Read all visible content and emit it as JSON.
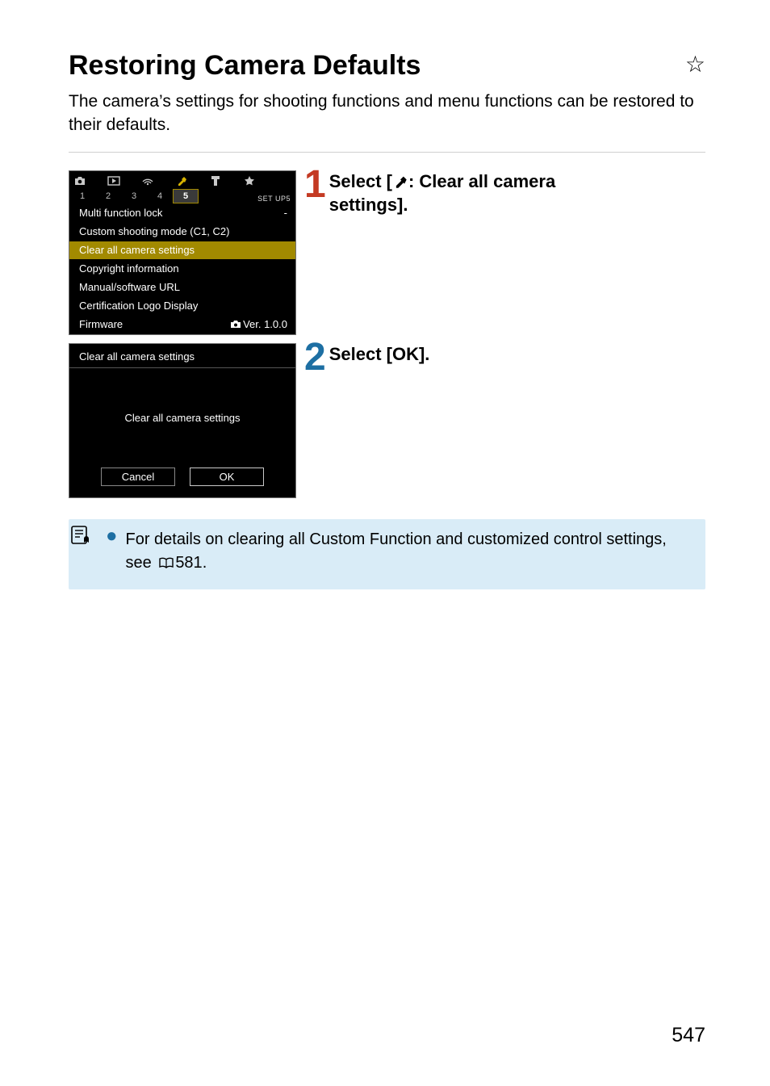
{
  "title": "Restoring Camera Defaults",
  "intro": "The camera’s settings for shooting functions and menu functions can be restored to their defaults.",
  "page_number": "547",
  "step1": {
    "label_pre": "Select [",
    "label_post": ": Clear all camera settings].",
    "lcd": {
      "subtabs": [
        "1",
        "2",
        "3",
        "4",
        "5"
      ],
      "active_subtab_index": 4,
      "setup_label": "SET UP5",
      "rows": [
        {
          "label": "Multi function lock",
          "value": "-"
        },
        {
          "label": "Custom shooting mode (C1, C2)",
          "value": ""
        },
        {
          "label": "Clear all camera settings",
          "value": "",
          "highlight": true
        },
        {
          "label": "Copyright information",
          "value": ""
        },
        {
          "label": "Manual/software URL",
          "value": ""
        },
        {
          "label": "Certification Logo Display",
          "value": ""
        },
        {
          "label": "Firmware",
          "value": "Ver. 1.0.0",
          "cam_icon": true
        }
      ]
    }
  },
  "step2": {
    "label": "Select [OK].",
    "lcd": {
      "title": "Clear all camera settings",
      "body": "Clear all camera settings",
      "cancel": "Cancel",
      "ok": "OK"
    }
  },
  "note": {
    "text_pre": "For details on clearing all Custom Function and customized control settings, see ",
    "page_ref": "581",
    "text_post": "."
  }
}
